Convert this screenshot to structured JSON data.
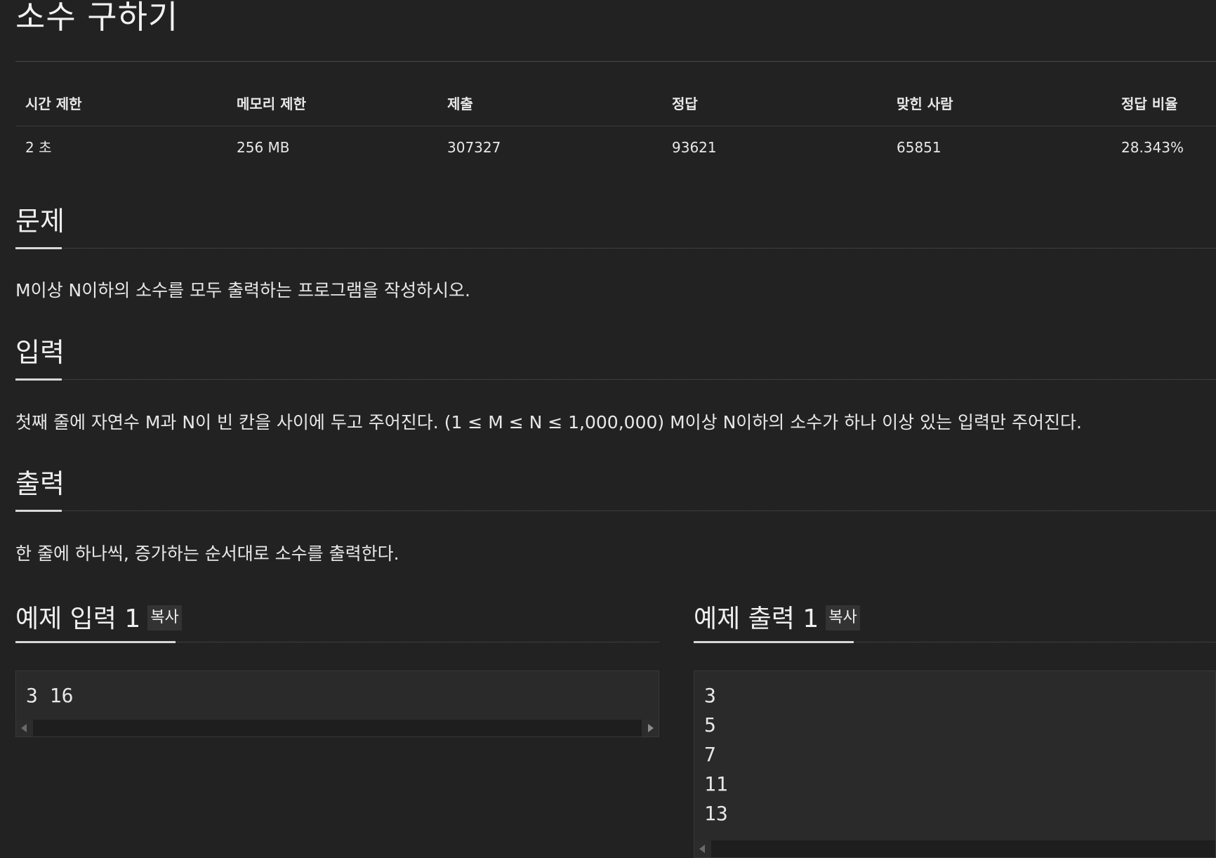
{
  "problem": {
    "title": "소수 구하기"
  },
  "info_table": {
    "headers": [
      "시간 제한",
      "메모리 제한",
      "제출",
      "정답",
      "맞힌 사람",
      "정답 비율"
    ],
    "values": [
      "2 초",
      "256 MB",
      "307327",
      "93621",
      "65851",
      "28.343%"
    ]
  },
  "sections": {
    "problem": {
      "heading": "문제",
      "body": "M이상 N이하의 소수를 모두 출력하는 프로그램을 작성하시오."
    },
    "input": {
      "heading": "입력",
      "body": "첫째 줄에 자연수 M과 N이 빈 칸을 사이에 두고 주어진다. (1 ≤ M ≤ N ≤ 1,000,000) M이상 N이하의 소수가 하나 이상 있는 입력만 주어진다."
    },
    "output": {
      "heading": "출력",
      "body": "한 줄에 하나씩, 증가하는 순서대로 소수를 출력한다."
    }
  },
  "samples": {
    "input": {
      "heading": "예제 입력 1",
      "copy_label": "복사",
      "lines": [
        "3 16"
      ]
    },
    "output": {
      "heading": "예제 출력 1",
      "copy_label": "복사",
      "lines": [
        "3",
        "5",
        "7",
        "11",
        "13"
      ]
    }
  },
  "colors": {
    "background": "#222222",
    "text": "#e8e8e8",
    "code_background": "#2a2a2a"
  }
}
